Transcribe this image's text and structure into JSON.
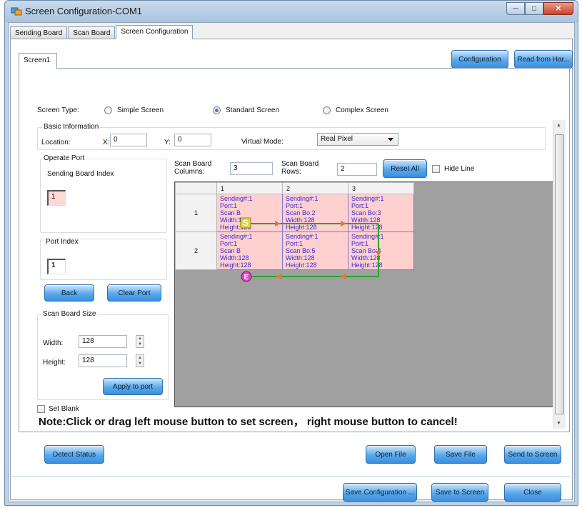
{
  "window": {
    "title": "Screen Configuration-COM1"
  },
  "tabs": [
    "Sending Board",
    "Scan Board",
    "Screen Configuration"
  ],
  "top_buttons": {
    "configuration": "Configuration",
    "read_from_hardware": "Read from Har..."
  },
  "screen_tab": "Screen1",
  "screen_type": {
    "label": "Screen Type:",
    "options": [
      "Simple Screen",
      "Standard Screen",
      "Complex Screen"
    ],
    "selected": "Standard Screen"
  },
  "basic_info": {
    "title": "Basic Information",
    "location_label": "Location:",
    "x_label": "X:",
    "x_value": "0",
    "y_label": "Y:",
    "y_value": "0",
    "virtual_mode_label": "Virtual Mode:",
    "virtual_mode_value": "Real Pixel"
  },
  "operate_port": {
    "title": "Operate Port",
    "sending_board_index_label": "Sending Board Index",
    "sending_board_index_value": "1",
    "port_index_label": "Port Index",
    "port_index_value": "1",
    "back_label": "Back",
    "clear_port_label": "Clear Port"
  },
  "scan_board_size": {
    "title": "Scan Board Size",
    "width_label": "Width:",
    "width_value": "128",
    "height_label": "Height:",
    "height_value": "128",
    "apply_label": "Apply to port"
  },
  "scan_grid_controls": {
    "columns_label_1": "Scan Board",
    "columns_label_2": "Columns:",
    "columns_value": "3",
    "rows_label_1": "Scan Board",
    "rows_label_2": "Rows:",
    "rows_value": "2",
    "reset_all_label": "Reset All",
    "hide_line_label": "Hide Line"
  },
  "grid": {
    "column_headers": [
      "1",
      "2",
      "3"
    ],
    "row_headers": [
      "1",
      "2"
    ],
    "rows": [
      [
        [
          "Sending#:1",
          "Port:1",
          "Scan B",
          "Width:128",
          "Height:128"
        ],
        [
          "Sending#:1",
          "Port:1",
          "Scan Bo:2",
          "Width:128",
          "Height:128"
        ],
        [
          "Sending#:1",
          "Port:1",
          "Scan Bo:3",
          "Width:128",
          "Height:128"
        ]
      ],
      [
        [
          "Sending#:1",
          "Port:1",
          "Scan B",
          "Width:128",
          "Height:128"
        ],
        [
          "Sending#:1",
          "Port:1",
          "Scan Bo:5",
          "Width:128",
          "Height:128"
        ],
        [
          "Sending#:1",
          "Port:1",
          "Scan Bo:4",
          "Width:128",
          "Height:128"
        ]
      ]
    ],
    "start_marker": "S",
    "end_marker": "E"
  },
  "set_blank_label": "Set Blank",
  "note": "Note:Click or drag left mouse button to set screen， right mouse button to cancel!",
  "bottom_buttons": {
    "detect_status": "Detect Status",
    "open_file": "Open File",
    "save_file": "Save File",
    "send_to_screen": "Send to Screen",
    "save_configuration": "Save Configuration ...",
    "save_to_screen": "Save to Screen",
    "close": "Close"
  },
  "colors": {
    "cell_fill": "#ffd0d0",
    "cell_text": "#3b2cd6",
    "route_line": "#2fa02f",
    "arrow": "#ff6a2a",
    "button": "#5aa8ea"
  }
}
